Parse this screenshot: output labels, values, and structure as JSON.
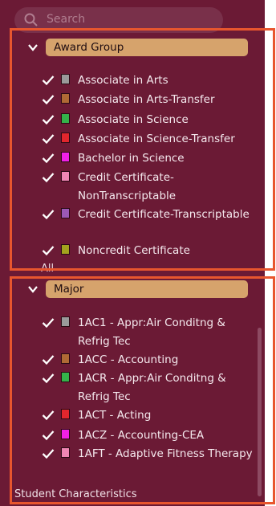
{
  "search": {
    "placeholder": "Search"
  },
  "award_group": {
    "label": "Award Group",
    "items": [
      {
        "label": "Associate in Arts",
        "color": "#9a9a9a"
      },
      {
        "label": "Associate in Arts-Transfer",
        "color": "#b06a35"
      },
      {
        "label": "Associate in Science",
        "color": "#34b24a"
      },
      {
        "label": "Associate in Science-Transfer",
        "color": "#e1262d"
      },
      {
        "label": "Bachelor in Science",
        "color": "#f020e6"
      },
      {
        "label": "Credit Certificate-NonTranscriptable",
        "color": "#ef86b4"
      },
      {
        "label": "Credit Certificate-Transcriptable",
        "color": "#9b59b6"
      },
      {
        "label": "Noncredit Certificate",
        "color": "#a3a31e"
      }
    ],
    "all_label": "All"
  },
  "major": {
    "label": "Major",
    "items": [
      {
        "label": "1AC1 - Appr:Air Conditng & Refrig Tec",
        "color": "#9a9a9a"
      },
      {
        "label": "1ACC - Accounting",
        "color": "#b06a35"
      },
      {
        "label": "1ACR - Appr:Air Conditng & Refrig Tec",
        "color": "#34b24a"
      },
      {
        "label": "1ACT - Acting",
        "color": "#e1262d"
      },
      {
        "label": "1ACZ - Accounting-CEA",
        "color": "#f020e6"
      },
      {
        "label": "1AFT - Adaptive Fitness Therapy",
        "color": "#ef86b4"
      }
    ]
  },
  "next_section": {
    "label": "Student Characteristics"
  },
  "colors": {
    "panel": "#6b1a35",
    "pill": "#d6a36c",
    "highlight": "#e8562e"
  }
}
